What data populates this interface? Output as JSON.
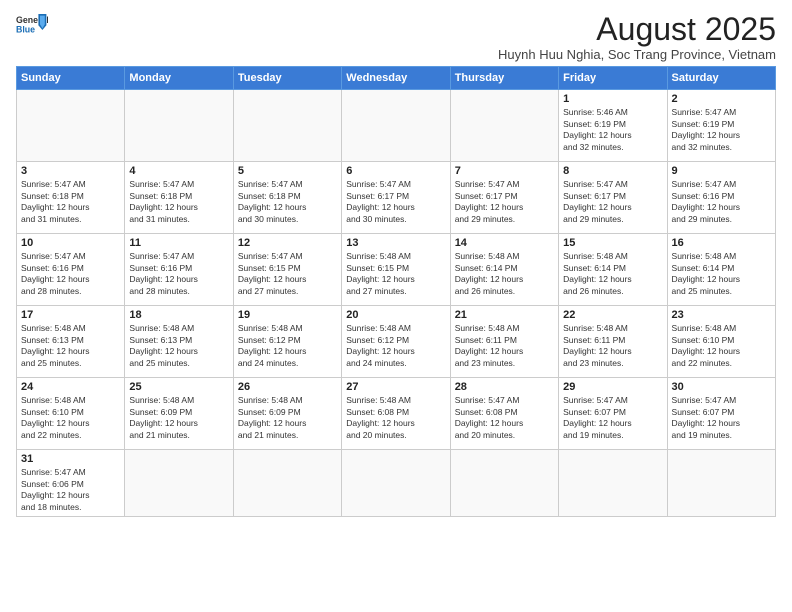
{
  "header": {
    "logo_general": "General",
    "logo_blue": "Blue",
    "month_title": "August 2025",
    "subtitle": "Huynh Huu Nghia, Soc Trang Province, Vietnam"
  },
  "days_of_week": [
    "Sunday",
    "Monday",
    "Tuesday",
    "Wednesday",
    "Thursday",
    "Friday",
    "Saturday"
  ],
  "weeks": [
    [
      {
        "day": "",
        "info": ""
      },
      {
        "day": "",
        "info": ""
      },
      {
        "day": "",
        "info": ""
      },
      {
        "day": "",
        "info": ""
      },
      {
        "day": "",
        "info": ""
      },
      {
        "day": "1",
        "info": "Sunrise: 5:46 AM\nSunset: 6:19 PM\nDaylight: 12 hours\nand 32 minutes."
      },
      {
        "day": "2",
        "info": "Sunrise: 5:47 AM\nSunset: 6:19 PM\nDaylight: 12 hours\nand 32 minutes."
      }
    ],
    [
      {
        "day": "3",
        "info": "Sunrise: 5:47 AM\nSunset: 6:18 PM\nDaylight: 12 hours\nand 31 minutes."
      },
      {
        "day": "4",
        "info": "Sunrise: 5:47 AM\nSunset: 6:18 PM\nDaylight: 12 hours\nand 31 minutes."
      },
      {
        "day": "5",
        "info": "Sunrise: 5:47 AM\nSunset: 6:18 PM\nDaylight: 12 hours\nand 30 minutes."
      },
      {
        "day": "6",
        "info": "Sunrise: 5:47 AM\nSunset: 6:17 PM\nDaylight: 12 hours\nand 30 minutes."
      },
      {
        "day": "7",
        "info": "Sunrise: 5:47 AM\nSunset: 6:17 PM\nDaylight: 12 hours\nand 29 minutes."
      },
      {
        "day": "8",
        "info": "Sunrise: 5:47 AM\nSunset: 6:17 PM\nDaylight: 12 hours\nand 29 minutes."
      },
      {
        "day": "9",
        "info": "Sunrise: 5:47 AM\nSunset: 6:16 PM\nDaylight: 12 hours\nand 29 minutes."
      }
    ],
    [
      {
        "day": "10",
        "info": "Sunrise: 5:47 AM\nSunset: 6:16 PM\nDaylight: 12 hours\nand 28 minutes."
      },
      {
        "day": "11",
        "info": "Sunrise: 5:47 AM\nSunset: 6:16 PM\nDaylight: 12 hours\nand 28 minutes."
      },
      {
        "day": "12",
        "info": "Sunrise: 5:47 AM\nSunset: 6:15 PM\nDaylight: 12 hours\nand 27 minutes."
      },
      {
        "day": "13",
        "info": "Sunrise: 5:48 AM\nSunset: 6:15 PM\nDaylight: 12 hours\nand 27 minutes."
      },
      {
        "day": "14",
        "info": "Sunrise: 5:48 AM\nSunset: 6:14 PM\nDaylight: 12 hours\nand 26 minutes."
      },
      {
        "day": "15",
        "info": "Sunrise: 5:48 AM\nSunset: 6:14 PM\nDaylight: 12 hours\nand 26 minutes."
      },
      {
        "day": "16",
        "info": "Sunrise: 5:48 AM\nSunset: 6:14 PM\nDaylight: 12 hours\nand 25 minutes."
      }
    ],
    [
      {
        "day": "17",
        "info": "Sunrise: 5:48 AM\nSunset: 6:13 PM\nDaylight: 12 hours\nand 25 minutes."
      },
      {
        "day": "18",
        "info": "Sunrise: 5:48 AM\nSunset: 6:13 PM\nDaylight: 12 hours\nand 25 minutes."
      },
      {
        "day": "19",
        "info": "Sunrise: 5:48 AM\nSunset: 6:12 PM\nDaylight: 12 hours\nand 24 minutes."
      },
      {
        "day": "20",
        "info": "Sunrise: 5:48 AM\nSunset: 6:12 PM\nDaylight: 12 hours\nand 24 minutes."
      },
      {
        "day": "21",
        "info": "Sunrise: 5:48 AM\nSunset: 6:11 PM\nDaylight: 12 hours\nand 23 minutes."
      },
      {
        "day": "22",
        "info": "Sunrise: 5:48 AM\nSunset: 6:11 PM\nDaylight: 12 hours\nand 23 minutes."
      },
      {
        "day": "23",
        "info": "Sunrise: 5:48 AM\nSunset: 6:10 PM\nDaylight: 12 hours\nand 22 minutes."
      }
    ],
    [
      {
        "day": "24",
        "info": "Sunrise: 5:48 AM\nSunset: 6:10 PM\nDaylight: 12 hours\nand 22 minutes."
      },
      {
        "day": "25",
        "info": "Sunrise: 5:48 AM\nSunset: 6:09 PM\nDaylight: 12 hours\nand 21 minutes."
      },
      {
        "day": "26",
        "info": "Sunrise: 5:48 AM\nSunset: 6:09 PM\nDaylight: 12 hours\nand 21 minutes."
      },
      {
        "day": "27",
        "info": "Sunrise: 5:48 AM\nSunset: 6:08 PM\nDaylight: 12 hours\nand 20 minutes."
      },
      {
        "day": "28",
        "info": "Sunrise: 5:47 AM\nSunset: 6:08 PM\nDaylight: 12 hours\nand 20 minutes."
      },
      {
        "day": "29",
        "info": "Sunrise: 5:47 AM\nSunset: 6:07 PM\nDaylight: 12 hours\nand 19 minutes."
      },
      {
        "day": "30",
        "info": "Sunrise: 5:47 AM\nSunset: 6:07 PM\nDaylight: 12 hours\nand 19 minutes."
      }
    ],
    [
      {
        "day": "31",
        "info": "Sunrise: 5:47 AM\nSunset: 6:06 PM\nDaylight: 12 hours\nand 18 minutes."
      },
      {
        "day": "",
        "info": ""
      },
      {
        "day": "",
        "info": ""
      },
      {
        "day": "",
        "info": ""
      },
      {
        "day": "",
        "info": ""
      },
      {
        "day": "",
        "info": ""
      },
      {
        "day": "",
        "info": ""
      }
    ]
  ]
}
